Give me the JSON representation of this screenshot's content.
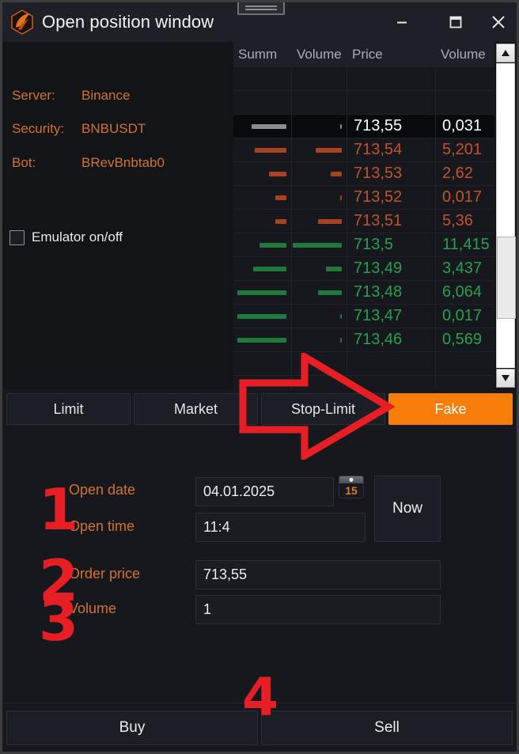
{
  "window": {
    "title": "Open position window",
    "logo_icon": "app-logo-icon",
    "minimize_icon": "minimize-icon",
    "maximize_icon": "maximize-icon",
    "close_icon": "close-icon",
    "resize_handle_icon": "resize-grip-icon"
  },
  "info": {
    "server_label": "Server:",
    "server_value": "Binance",
    "security_label": "Security:",
    "security_value": "BNBUSDT",
    "bot_label": "Bot:",
    "bot_value": "BRevBnbtab0",
    "emulator_label": "Emulator on/off",
    "emulator_checked": false
  },
  "orderbook": {
    "columns": [
      "Summ",
      "Volume",
      "Price",
      "Volume"
    ],
    "scroll_up_icon": "scroll-up-arrow-icon",
    "scroll_down_icon": "scroll-down-arrow-icon",
    "rows": [
      {
        "kind": "empty",
        "summ": "",
        "vol1": "",
        "price": "",
        "vol2": "",
        "summ_bar": 0,
        "vol_bar": 0
      },
      {
        "kind": "empty",
        "summ": "",
        "vol1": "",
        "price": "",
        "vol2": "",
        "summ_bar": 0,
        "vol_bar": 0
      },
      {
        "kind": "current",
        "summ": "",
        "vol1": "",
        "price": "713,55",
        "vol2": "0,031",
        "summ_bar": 44,
        "vol_bar": 2
      },
      {
        "kind": "ask",
        "summ": "",
        "vol1": "",
        "price": "713,54",
        "vol2": "5,201",
        "summ_bar": 40,
        "vol_bar": 33
      },
      {
        "kind": "ask",
        "summ": "",
        "vol1": "",
        "price": "713,53",
        "vol2": "2,62",
        "summ_bar": 22,
        "vol_bar": 14
      },
      {
        "kind": "ask",
        "summ": "",
        "vol1": "",
        "price": "713,52",
        "vol2": "0,017",
        "summ_bar": 14,
        "vol_bar": 2
      },
      {
        "kind": "ask",
        "summ": "",
        "vol1": "",
        "price": "713,51",
        "vol2": "5,36",
        "summ_bar": 14,
        "vol_bar": 30
      },
      {
        "kind": "bid",
        "summ": "",
        "vol1": "",
        "price": "713,5",
        "vol2": "11,415",
        "summ_bar": 34,
        "vol_bar": 62
      },
      {
        "kind": "bid",
        "summ": "",
        "vol1": "",
        "price": "713,49",
        "vol2": "3,437",
        "summ_bar": 42,
        "vol_bar": 20
      },
      {
        "kind": "bid",
        "summ": "",
        "vol1": "",
        "price": "713,48",
        "vol2": "6,064",
        "summ_bar": 62,
        "vol_bar": 30
      },
      {
        "kind": "bid",
        "summ": "",
        "vol1": "",
        "price": "713,47",
        "vol2": "0,017",
        "summ_bar": 62,
        "vol_bar": 2
      },
      {
        "kind": "bid",
        "summ": "",
        "vol1": "",
        "price": "713,46",
        "vol2": "0,569",
        "summ_bar": 62,
        "vol_bar": 2
      },
      {
        "kind": "empty",
        "summ": "",
        "vol1": "",
        "price": "",
        "vol2": "",
        "summ_bar": 0,
        "vol_bar": 0
      },
      {
        "kind": "empty",
        "summ": "",
        "vol1": "",
        "price": "",
        "vol2": "",
        "summ_bar": 0,
        "vol_bar": 0
      }
    ]
  },
  "tabs": [
    {
      "label": "Limit",
      "active": false
    },
    {
      "label": "Market",
      "active": false
    },
    {
      "label": "Stop-Limit",
      "active": false
    },
    {
      "label": "Fake",
      "active": true
    }
  ],
  "form": {
    "open_date_label": "Open date",
    "open_date_value": "04.01.2025",
    "calendar_icon": "calendar-icon",
    "calendar_day": "15",
    "open_time_label": "Open time",
    "open_time_value": "11:4",
    "now_label": "Now",
    "order_price_label": "Order price",
    "order_price_value": "713,55",
    "volume_label": "Volume",
    "volume_value": "1"
  },
  "actions": {
    "buy_label": "Buy",
    "sell_label": "Sell"
  },
  "annotations": {
    "step1": "1",
    "step2": "2",
    "step3": "3",
    "step4": "4",
    "arrow_icon": "right-arrow-annotation-icon",
    "color": "#e81e25"
  },
  "colors": {
    "accent_orange": "#f77d0a",
    "label_orange": "#d1742e",
    "ask_red": "#c2522a",
    "bid_green": "#27a050",
    "annotation_red": "#e81e25",
    "panel_bg": "#16181d"
  }
}
